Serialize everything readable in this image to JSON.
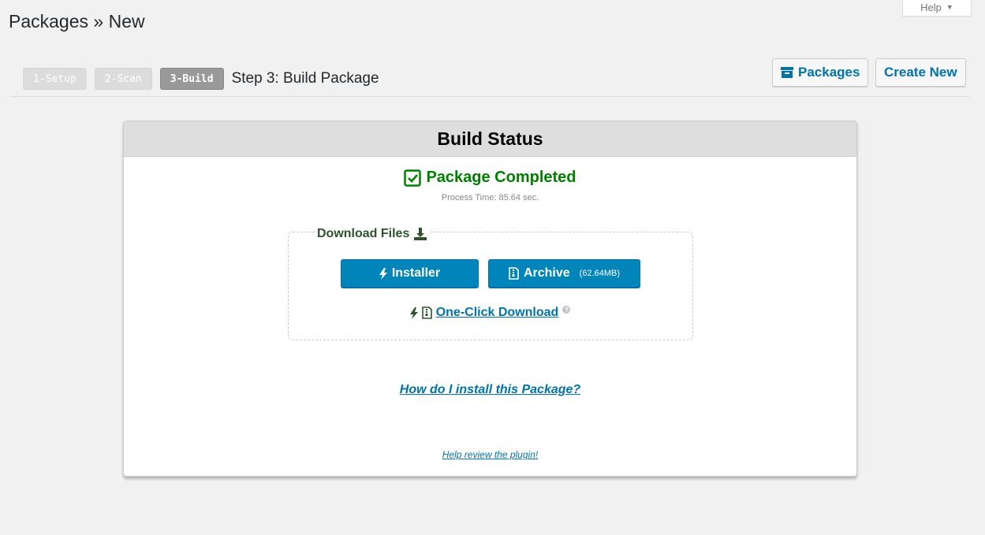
{
  "help": {
    "label": "Help"
  },
  "page": {
    "title": "Packages » New"
  },
  "steps": {
    "items": [
      "1-Setup",
      "2-Scan",
      "3-Build"
    ],
    "active_title": "Step 3: Build Package"
  },
  "toolbar": {
    "packages_label": "Packages",
    "create_new_label": "Create New"
  },
  "panel": {
    "header": "Build Status",
    "status": "Package Completed",
    "process_time_label": "Process Time:",
    "process_time_value": "85.64 sec.",
    "download_title": "Download Files",
    "installer_label": "Installer",
    "archive_label": "Archive",
    "archive_size": "(62.64MB)",
    "one_click_label": "One-Click Download",
    "how_install_label": "How do I install this Package?",
    "review_label": "Help review the plugin!"
  },
  "colors": {
    "accent": "#0085ba",
    "success": "#008000",
    "link": "#0073aa"
  },
  "icons": [
    "caret-down-icon",
    "archive-box-icon",
    "check-square-icon",
    "download-icon",
    "bolt-icon",
    "file-zip-icon",
    "help-circle-icon"
  ]
}
